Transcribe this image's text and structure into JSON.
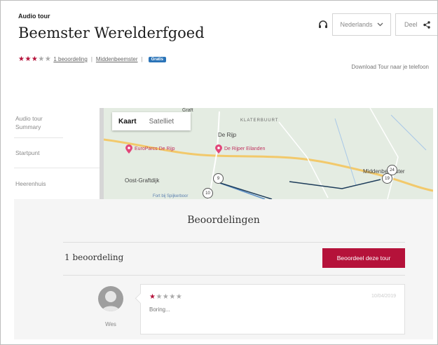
{
  "header": {
    "subtitle": "Audio tour",
    "title": "Beemster Werelderfgoed",
    "rating_stars_filled": "★★★",
    "rating_stars_empty": "★★",
    "rating_link": "1 beoordeling",
    "location_link": "Middenbeemster",
    "badge": "Gratis",
    "language": "Nederlands",
    "share": "Deel",
    "download": "Download Tour naar je telefoon"
  },
  "sidebar": {
    "items": [
      {
        "label": "Audio tour Summary"
      },
      {
        "label": "Startpunt"
      },
      {
        "label": "Heerenhuis"
      }
    ]
  },
  "map": {
    "tabs": [
      "Kaart",
      "Satelliet"
    ],
    "labels": {
      "europarcs": "EuroParcs De Rijp",
      "dejipereilanden": "De Rijper Eilanden",
      "derijp": "De Rijp",
      "klaterbuurt": "KLATERBUURT",
      "oostgraftdijk": "Oost-Graftdijk",
      "middenbeemster": "Middenbeemster",
      "graft": "Graft",
      "fort": "Fort bij Spijkerboor"
    },
    "markers": [
      "9",
      "10",
      "19",
      "24"
    ]
  },
  "reviews": {
    "title": "Beoordelingen",
    "count": "1 beoordeling",
    "rate_button": "Beoordeel deze tour",
    "items": [
      {
        "name": "Wes",
        "stars_filled": "★",
        "stars_empty": "★★★★",
        "rating": 1,
        "date": "10/04/2019",
        "text": "Boring..."
      }
    ]
  },
  "colors": {
    "accent": "#b5123a",
    "badge": "#2b74b8"
  }
}
